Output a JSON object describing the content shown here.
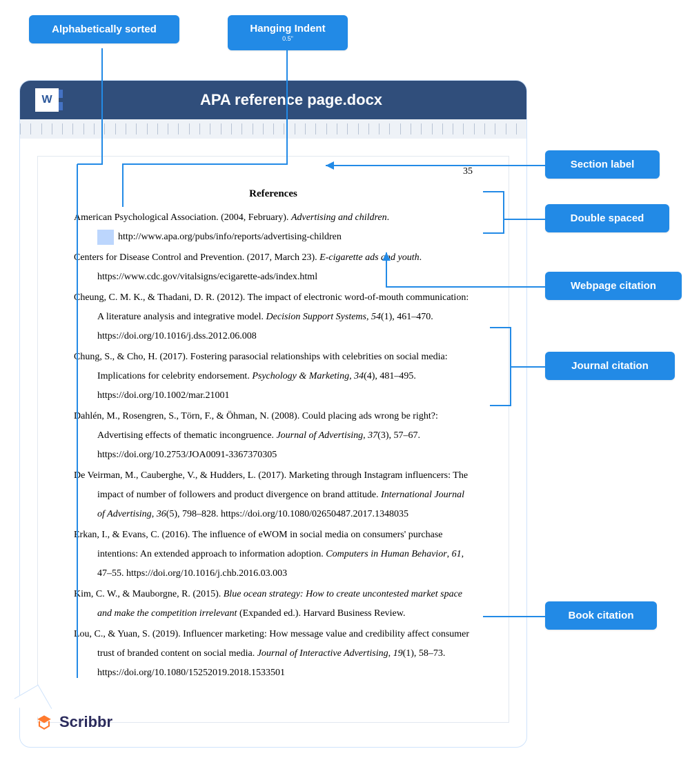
{
  "top_labels": {
    "alpha": "Alphabetically sorted",
    "indent_main": "Hanging Indent",
    "indent_sub": "0.5\""
  },
  "side_labels": {
    "section": "Section label",
    "double": "Double spaced",
    "webpage": "Webpage citation",
    "journal": "Journal citation",
    "book": "Book citation"
  },
  "doc": {
    "title": "APA reference page.docx",
    "page_number": "35",
    "heading": "References",
    "word_mark": "W"
  },
  "refs": [
    {
      "plain1": "American Psychological Association. (2004, February). ",
      "italic1": "Advertising and children",
      "plain2": ". http://www.apa.org/pubs/info/reports/advertising-children",
      "show_box": true
    },
    {
      "plain1": "Centers for Disease Control and Prevention. (2017, March 23). ",
      "italic1": "E-cigarette ads and youth",
      "plain2": ". https://www.cdc.gov/vitalsigns/ecigarette-ads/index.html"
    },
    {
      "plain1": "Cheung, C. M. K., & Thadani, D. R. (2012). The impact of electronic word-of-mouth communication: A literature analysis and integrative model. ",
      "italic1": "Decision Support Systems",
      "plain2": ", ",
      "italic2": "54",
      "plain3": "(1), 461–470. https://doi.org/10.1016/j.dss.2012.06.008"
    },
    {
      "plain1": "Chung, S., & Cho, H. (2017). Fostering parasocial relationships with celebrities on social media: Implications for celebrity endorsement. ",
      "italic1": "Psychology & Marketing",
      "plain2": ", ",
      "italic2": "34",
      "plain3": "(4), 481–495. https://doi.org/10.1002/mar.21001"
    },
    {
      "plain1": "Dahlén, M., Rosengren, S., Törn, F., & Öhman, N. (2008). Could placing ads wrong be right?: Advertising effects of thematic incongruence. ",
      "italic1": "Journal of Advertising",
      "plain2": ", ",
      "italic2": "37",
      "plain3": "(3), 57–67. https://doi.org/10.2753/JOA0091-3367370305"
    },
    {
      "plain1": "De Veirman, M., Cauberghe, V., & Hudders, L. (2017). Marketing through Instagram influencers: The impact of number of followers and product divergence on brand attitude. ",
      "italic1": "International Journal of Advertising",
      "plain2": ", ",
      "italic2": "36",
      "plain3": "(5), 798–828. https://doi.org/10.1080/02650487.2017.1348035"
    },
    {
      "plain1": "Erkan, I., & Evans, C. (2016). The influence of eWOM in social media on consumers' purchase intentions: An extended approach to information adoption. ",
      "italic1": "Computers in Human Behavior",
      "plain2": ", ",
      "italic2": "61",
      "plain3": ", 47–55. https://doi.org/10.1016/j.chb.2016.03.003"
    },
    {
      "plain1": "Kim, C. W., & Mauborgne, R. (2015). ",
      "italic1": "Blue ocean strategy: How to create uncontested market space and make the competition irrelevant",
      "plain2": " (Expanded ed.). Harvard Business Review."
    },
    {
      "plain1": "Lou, C., & Yuan, S. (2019). Influencer marketing: How message value and credibility affect consumer trust of branded content on social media. ",
      "italic1": "Journal of Interactive Advertising",
      "plain2": ", ",
      "italic2": "19",
      "plain3": "(1), 58–73. https://doi.org/10.1080/15252019.2018.1533501"
    }
  ],
  "brand": "Scribbr"
}
